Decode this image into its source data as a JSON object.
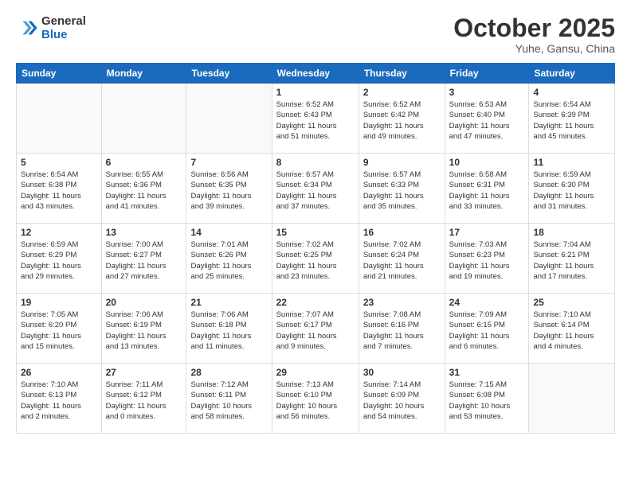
{
  "header": {
    "logo_line1": "General",
    "logo_line2": "Blue",
    "month": "October 2025",
    "location": "Yuhe, Gansu, China"
  },
  "weekdays": [
    "Sunday",
    "Monday",
    "Tuesday",
    "Wednesday",
    "Thursday",
    "Friday",
    "Saturday"
  ],
  "weeks": [
    [
      {
        "num": "",
        "info": ""
      },
      {
        "num": "",
        "info": ""
      },
      {
        "num": "",
        "info": ""
      },
      {
        "num": "1",
        "info": "Sunrise: 6:52 AM\nSunset: 6:43 PM\nDaylight: 11 hours\nand 51 minutes."
      },
      {
        "num": "2",
        "info": "Sunrise: 6:52 AM\nSunset: 6:42 PM\nDaylight: 11 hours\nand 49 minutes."
      },
      {
        "num": "3",
        "info": "Sunrise: 6:53 AM\nSunset: 6:40 PM\nDaylight: 11 hours\nand 47 minutes."
      },
      {
        "num": "4",
        "info": "Sunrise: 6:54 AM\nSunset: 6:39 PM\nDaylight: 11 hours\nand 45 minutes."
      }
    ],
    [
      {
        "num": "5",
        "info": "Sunrise: 6:54 AM\nSunset: 6:38 PM\nDaylight: 11 hours\nand 43 minutes."
      },
      {
        "num": "6",
        "info": "Sunrise: 6:55 AM\nSunset: 6:36 PM\nDaylight: 11 hours\nand 41 minutes."
      },
      {
        "num": "7",
        "info": "Sunrise: 6:56 AM\nSunset: 6:35 PM\nDaylight: 11 hours\nand 39 minutes."
      },
      {
        "num": "8",
        "info": "Sunrise: 6:57 AM\nSunset: 6:34 PM\nDaylight: 11 hours\nand 37 minutes."
      },
      {
        "num": "9",
        "info": "Sunrise: 6:57 AM\nSunset: 6:33 PM\nDaylight: 11 hours\nand 35 minutes."
      },
      {
        "num": "10",
        "info": "Sunrise: 6:58 AM\nSunset: 6:31 PM\nDaylight: 11 hours\nand 33 minutes."
      },
      {
        "num": "11",
        "info": "Sunrise: 6:59 AM\nSunset: 6:30 PM\nDaylight: 11 hours\nand 31 minutes."
      }
    ],
    [
      {
        "num": "12",
        "info": "Sunrise: 6:59 AM\nSunset: 6:29 PM\nDaylight: 11 hours\nand 29 minutes."
      },
      {
        "num": "13",
        "info": "Sunrise: 7:00 AM\nSunset: 6:27 PM\nDaylight: 11 hours\nand 27 minutes."
      },
      {
        "num": "14",
        "info": "Sunrise: 7:01 AM\nSunset: 6:26 PM\nDaylight: 11 hours\nand 25 minutes."
      },
      {
        "num": "15",
        "info": "Sunrise: 7:02 AM\nSunset: 6:25 PM\nDaylight: 11 hours\nand 23 minutes."
      },
      {
        "num": "16",
        "info": "Sunrise: 7:02 AM\nSunset: 6:24 PM\nDaylight: 11 hours\nand 21 minutes."
      },
      {
        "num": "17",
        "info": "Sunrise: 7:03 AM\nSunset: 6:23 PM\nDaylight: 11 hours\nand 19 minutes."
      },
      {
        "num": "18",
        "info": "Sunrise: 7:04 AM\nSunset: 6:21 PM\nDaylight: 11 hours\nand 17 minutes."
      }
    ],
    [
      {
        "num": "19",
        "info": "Sunrise: 7:05 AM\nSunset: 6:20 PM\nDaylight: 11 hours\nand 15 minutes."
      },
      {
        "num": "20",
        "info": "Sunrise: 7:06 AM\nSunset: 6:19 PM\nDaylight: 11 hours\nand 13 minutes."
      },
      {
        "num": "21",
        "info": "Sunrise: 7:06 AM\nSunset: 6:18 PM\nDaylight: 11 hours\nand 11 minutes."
      },
      {
        "num": "22",
        "info": "Sunrise: 7:07 AM\nSunset: 6:17 PM\nDaylight: 11 hours\nand 9 minutes."
      },
      {
        "num": "23",
        "info": "Sunrise: 7:08 AM\nSunset: 6:16 PM\nDaylight: 11 hours\nand 7 minutes."
      },
      {
        "num": "24",
        "info": "Sunrise: 7:09 AM\nSunset: 6:15 PM\nDaylight: 11 hours\nand 6 minutes."
      },
      {
        "num": "25",
        "info": "Sunrise: 7:10 AM\nSunset: 6:14 PM\nDaylight: 11 hours\nand 4 minutes."
      }
    ],
    [
      {
        "num": "26",
        "info": "Sunrise: 7:10 AM\nSunset: 6:13 PM\nDaylight: 11 hours\nand 2 minutes."
      },
      {
        "num": "27",
        "info": "Sunrise: 7:11 AM\nSunset: 6:12 PM\nDaylight: 11 hours\nand 0 minutes."
      },
      {
        "num": "28",
        "info": "Sunrise: 7:12 AM\nSunset: 6:11 PM\nDaylight: 10 hours\nand 58 minutes."
      },
      {
        "num": "29",
        "info": "Sunrise: 7:13 AM\nSunset: 6:10 PM\nDaylight: 10 hours\nand 56 minutes."
      },
      {
        "num": "30",
        "info": "Sunrise: 7:14 AM\nSunset: 6:09 PM\nDaylight: 10 hours\nand 54 minutes."
      },
      {
        "num": "31",
        "info": "Sunrise: 7:15 AM\nSunset: 6:08 PM\nDaylight: 10 hours\nand 53 minutes."
      },
      {
        "num": "",
        "info": ""
      }
    ]
  ]
}
